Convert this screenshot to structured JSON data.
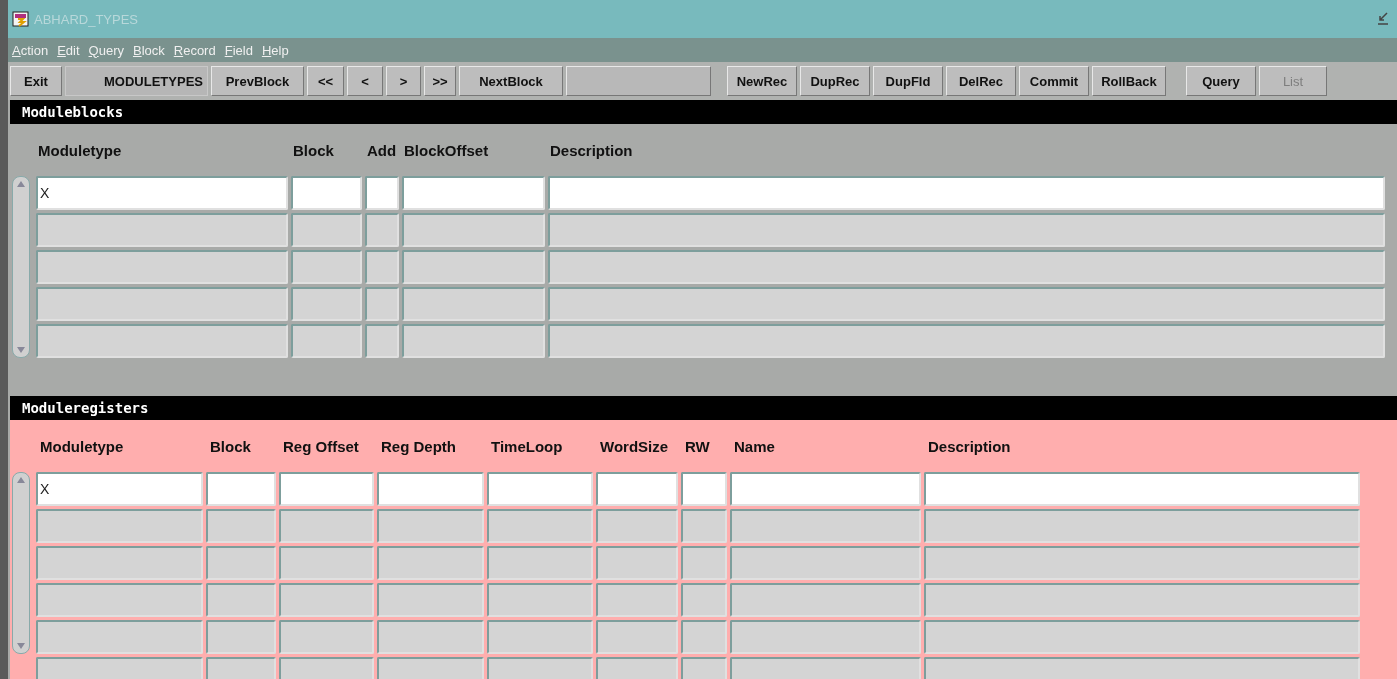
{
  "window": {
    "title": "ABHARD_TYPES"
  },
  "menu": [
    "Action",
    "Edit",
    "Query",
    "Block",
    "Record",
    "Field",
    "Help"
  ],
  "toolbar": [
    {
      "label": "Exit",
      "kind": "button",
      "disabled": false
    },
    {
      "label": "MODULETYPES",
      "kind": "flat",
      "disabled": false
    },
    {
      "label": "PrevBlock",
      "kind": "button",
      "disabled": false
    },
    {
      "label": "<<",
      "kind": "button",
      "disabled": false
    },
    {
      "label": "<",
      "kind": "button",
      "disabled": false
    },
    {
      "label": ">",
      "kind": "button",
      "disabled": false
    },
    {
      "label": ">>",
      "kind": "button",
      "disabled": false
    },
    {
      "label": "NextBlock",
      "kind": "button",
      "disabled": false
    },
    {
      "kind": "blank"
    },
    {
      "kind": "gap"
    },
    {
      "label": "NewRec",
      "kind": "button",
      "disabled": false
    },
    {
      "label": "DupRec",
      "kind": "button",
      "disabled": false
    },
    {
      "label": "DupFld",
      "kind": "button",
      "disabled": false
    },
    {
      "label": "DelRec",
      "kind": "button",
      "disabled": false
    },
    {
      "label": "Commit",
      "kind": "button",
      "disabled": false
    },
    {
      "label": "RollBack",
      "kind": "button",
      "disabled": false
    },
    {
      "kind": "gap"
    },
    {
      "label": "Query",
      "kind": "button",
      "disabled": false
    },
    {
      "label": "List",
      "kind": "button",
      "disabled": true
    }
  ],
  "blocks": [
    {
      "title": "Moduleblocks",
      "color": "#a8aaa8",
      "columns": [
        "Moduletype",
        "Block",
        "Add",
        "BlockOffset",
        "Description"
      ],
      "rows": [
        {
          "current": true,
          "cells": [
            "X"
          ]
        },
        {
          "current": false
        },
        {
          "current": false
        },
        {
          "current": false
        },
        {
          "current": false
        }
      ]
    },
    {
      "title": "Moduleregisters",
      "color": "#ffaeae",
      "columns": [
        "Moduletype",
        "Block",
        "Reg Offset",
        "Reg Depth",
        "TimeLoop",
        "WordSize",
        "RW",
        "Name",
        "Description"
      ],
      "rows": [
        {
          "current": true,
          "cells": [
            "X"
          ]
        },
        {
          "current": false
        },
        {
          "current": false
        },
        {
          "current": false
        },
        {
          "current": false
        },
        {
          "current": false
        }
      ]
    }
  ]
}
